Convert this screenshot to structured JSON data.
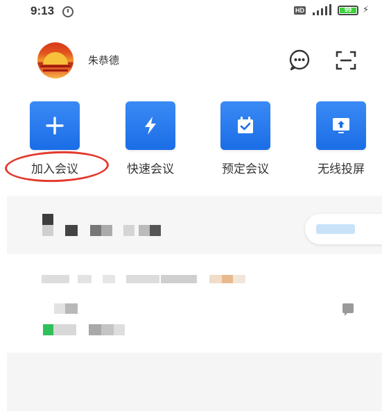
{
  "status_bar": {
    "time": "9:13",
    "hd_label": "HD",
    "battery_level": "99",
    "icons": [
      "alarm-icon",
      "signal-icon",
      "battery-icon",
      "charging-icon"
    ]
  },
  "profile": {
    "name": "朱恭德"
  },
  "header_icons": [
    "chat-icon",
    "scan-icon"
  ],
  "actions": [
    {
      "label": "加入会议",
      "icon": "plus-icon"
    },
    {
      "label": "快速会议",
      "icon": "lightning-icon"
    },
    {
      "label": "预定会议",
      "icon": "calendar-check-icon"
    },
    {
      "label": "无线投屏",
      "icon": "screen-cast-icon"
    }
  ],
  "colors": {
    "tile_blue": "#1b6de6",
    "annotation_red": "#e23a2e",
    "accent_green": "#2fbf5b"
  }
}
